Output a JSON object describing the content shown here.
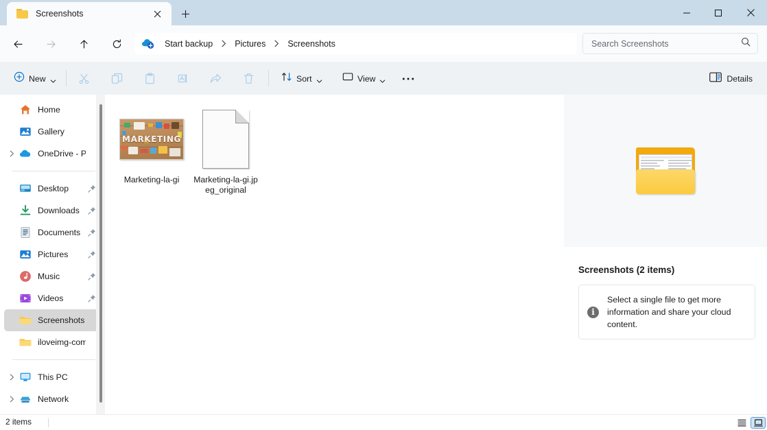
{
  "window": {
    "controls": {
      "minimize": "minimize-button",
      "maximize": "maximize-button",
      "close": "close-button"
    }
  },
  "tabs": {
    "items": [
      {
        "label": "Screenshots",
        "icon": "folder-icon",
        "active": true
      }
    ],
    "close_label": "✕",
    "new_tab_label": "+"
  },
  "nav": {
    "back": "←",
    "forward": "→",
    "up": "↑",
    "refresh": "⟳"
  },
  "breadcrumb": {
    "cloud_icon": "onedrive-cloud-icon",
    "items": [
      "Start backup",
      "Pictures",
      "Screenshots"
    ],
    "separator": "›"
  },
  "search": {
    "placeholder": "Search Screenshots",
    "value": "",
    "icon": "search-icon"
  },
  "toolbar": {
    "new_label": "New",
    "cut_label": "Cut",
    "copy_label": "Copy",
    "paste_label": "Paste",
    "rename_label": "Rename",
    "share_label": "Share",
    "delete_label": "Delete",
    "sort_label": "Sort",
    "view_label": "View",
    "more_label": "•••",
    "details_label": "Details"
  },
  "sidebar": {
    "items": [
      {
        "label": "Home",
        "icon": "home-icon",
        "expandable": false,
        "pinned": false,
        "selected": false
      },
      {
        "label": "Gallery",
        "icon": "gallery-icon",
        "expandable": false,
        "pinned": false,
        "selected": false
      },
      {
        "label": "OneDrive - Pers",
        "icon": "onedrive-icon",
        "expandable": true,
        "pinned": false,
        "selected": false
      },
      {
        "divider": true
      },
      {
        "label": "Desktop",
        "icon": "desktop-icon",
        "expandable": false,
        "pinned": true,
        "selected": false
      },
      {
        "label": "Downloads",
        "icon": "downloads-icon",
        "expandable": false,
        "pinned": true,
        "selected": false
      },
      {
        "label": "Documents",
        "icon": "documents-icon",
        "expandable": false,
        "pinned": true,
        "selected": false
      },
      {
        "label": "Pictures",
        "icon": "pictures-icon",
        "expandable": false,
        "pinned": true,
        "selected": false
      },
      {
        "label": "Music",
        "icon": "music-icon",
        "expandable": false,
        "pinned": true,
        "selected": false
      },
      {
        "label": "Videos",
        "icon": "videos-icon",
        "expandable": false,
        "pinned": true,
        "selected": false
      },
      {
        "label": "Screenshots",
        "icon": "folder-icon",
        "expandable": false,
        "pinned": false,
        "selected": true
      },
      {
        "label": "iloveimg-compr",
        "icon": "folder-icon",
        "expandable": false,
        "pinned": false,
        "selected": false
      },
      {
        "divider": true
      },
      {
        "label": "This PC",
        "icon": "this-pc-icon",
        "expandable": true,
        "pinned": false,
        "selected": false
      },
      {
        "label": "Network",
        "icon": "network-icon",
        "expandable": true,
        "pinned": false,
        "selected": false
      }
    ]
  },
  "files": {
    "items": [
      {
        "name": "Marketing-la-gi",
        "type": "image-thumbnail",
        "thumb_text": "MARKETING"
      },
      {
        "name": "Marketing-la-gi.jpeg_original",
        "type": "generic-file"
      }
    ]
  },
  "details_pane": {
    "preview_icon": "folder-preview-icon",
    "title": "Screenshots (2 items)",
    "info_icon": "info-icon",
    "info_text": "Select a single file to get more information and share your cloud content."
  },
  "statusbar": {
    "item_count": "2 items",
    "list_view_label": "list-view",
    "tiles_view_label": "large-icons-view"
  },
  "colors": {
    "titlebar": "#c9dbe9",
    "toolbar": "#eef2f5",
    "folder_yellow": "#f7c948",
    "accent_blue": "#0067c0",
    "selection_gray": "#d7d7d7"
  }
}
